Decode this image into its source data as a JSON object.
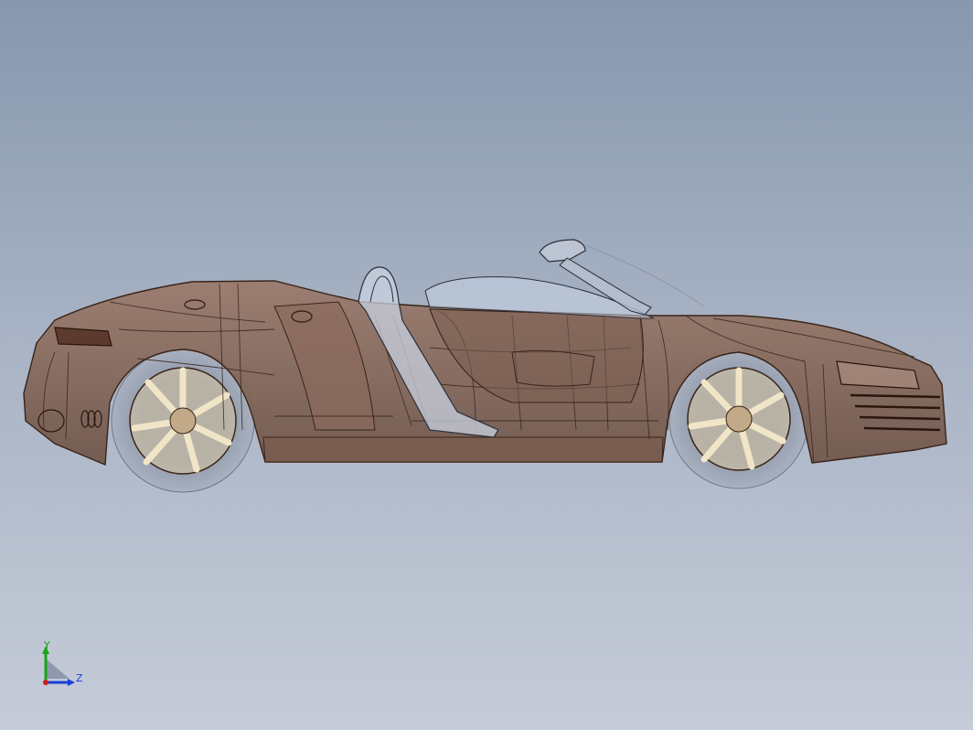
{
  "view": {
    "background_top": "#8797ad",
    "background_bottom": "#c6ccd8",
    "body_color": "#8a6a5c",
    "wheel_color": "#d9c7a2",
    "tire_color": "#9ba3b3",
    "edge_color": "#3a2418"
  },
  "triad": {
    "y_label": "Y",
    "z_label": "Z",
    "y_color": "#1aa51a",
    "z_color": "#1a3fd6",
    "x_color": "#d01a1a"
  }
}
